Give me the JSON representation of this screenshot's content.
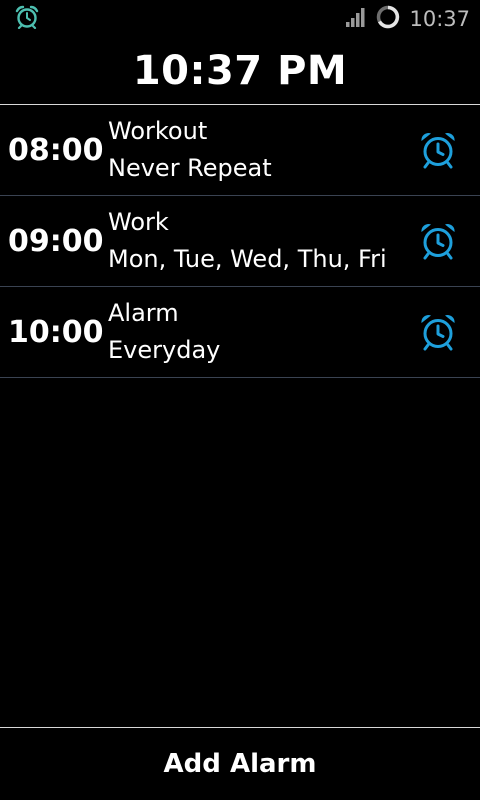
{
  "status_bar": {
    "notification_icon": "alarm-clock-icon",
    "signal_icon": "cell-signal-icon",
    "loading_icon": "sync-ring-icon",
    "time": "10:37"
  },
  "header": {
    "current_time": "10:37 PM"
  },
  "alarms": [
    {
      "time": "08:00",
      "name": "Workout",
      "repeat": "Never Repeat",
      "icon": "alarm-clock-icon"
    },
    {
      "time": "09:00",
      "name": "Work",
      "repeat": "Mon, Tue, Wed, Thu, Fri",
      "icon": "alarm-clock-icon"
    },
    {
      "time": "10:00",
      "name": "Alarm",
      "repeat": "Everyday",
      "icon": "alarm-clock-icon"
    }
  ],
  "footer": {
    "add_label": "Add Alarm"
  },
  "colors": {
    "accent": "#1ea0dc",
    "status_icon": "#4dbfb0",
    "divider": "#3a4352"
  }
}
